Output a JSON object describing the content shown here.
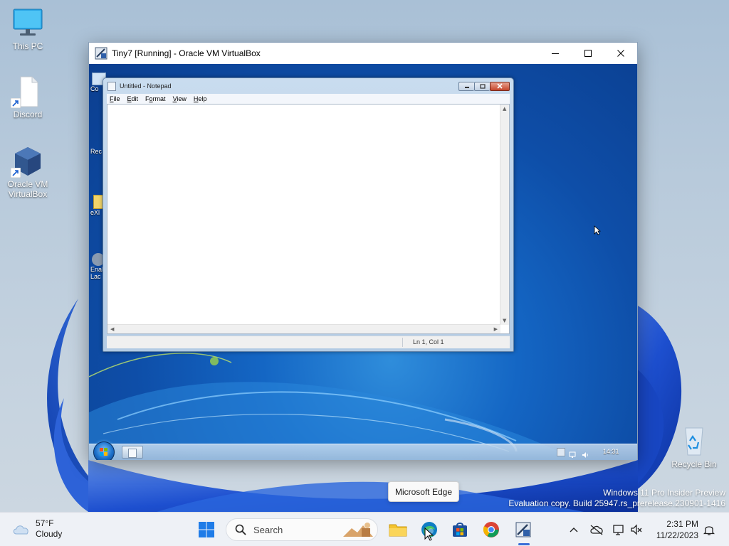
{
  "desktop": {
    "icons": [
      {
        "label": "This PC"
      },
      {
        "label": "Discord"
      },
      {
        "label": "Oracle VM VirtualBox"
      }
    ],
    "recycle_bin": {
      "label": "Recycle Bin"
    },
    "watermark": {
      "line1": "Windows 11 Pro Insider Preview",
      "line2": "Evaluation copy. Build 25947.rs_prerelease.230901-1416"
    },
    "tooltip": "Microsoft Edge"
  },
  "vbox_window": {
    "title": "Tiny7 [Running] - Oracle VM VirtualBox"
  },
  "guest": {
    "desktop_icons": [
      {
        "label": "Co"
      },
      {
        "label": "Rec"
      },
      {
        "label": "eXl"
      },
      {
        "label": "Enal Lac"
      }
    ],
    "notepad": {
      "title": "Untitled - Notepad",
      "menu": [
        {
          "label": "File",
          "accel": "F",
          "rest": "ile"
        },
        {
          "label": "Edit",
          "accel": "E",
          "rest": "dit"
        },
        {
          "label": "Format",
          "accel": "o",
          "pre": "F",
          "rest": "rmat"
        },
        {
          "label": "View",
          "accel": "V",
          "rest": "iew"
        },
        {
          "label": "Help",
          "accel": "H",
          "rest": "elp"
        }
      ],
      "status": "Ln 1, Col 1"
    },
    "clock": "14:31"
  },
  "taskbar": {
    "weather": {
      "temp": "57°F",
      "condition": "Cloudy"
    },
    "search_placeholder": "Search",
    "clock": {
      "time": "2:31 PM",
      "date": "11/22/2023"
    }
  }
}
